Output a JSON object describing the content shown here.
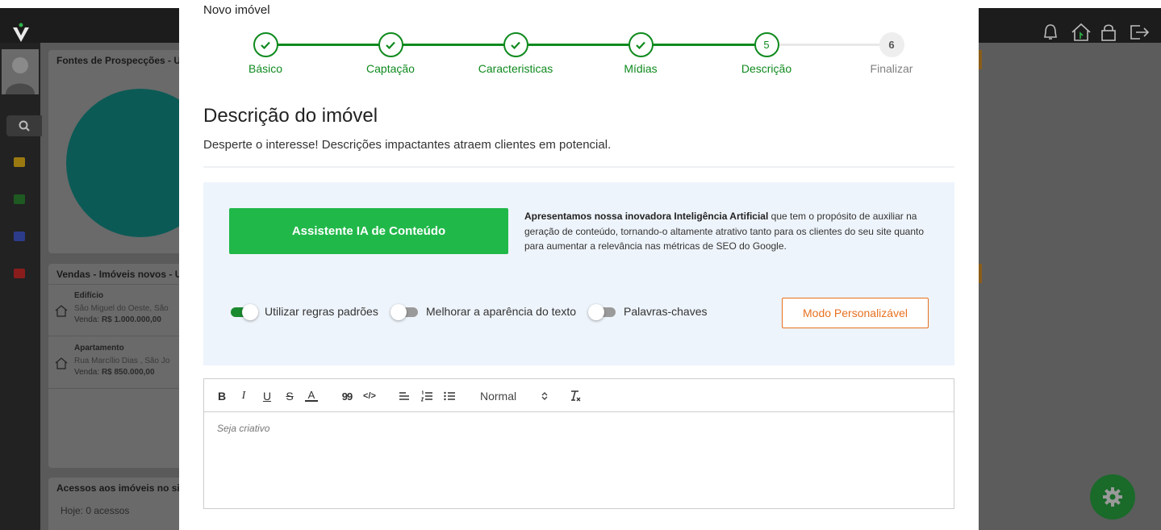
{
  "background": {
    "panels": {
      "sources_title": "Fontes de Prospecções - U",
      "sales_title": "Vendas - Imóveis novos - U",
      "access_title": "Acessos aos imóveis no si",
      "access_today_label": "Hoje:",
      "access_today_value": "0 acessos"
    },
    "sales_items": [
      {
        "type": "Edifício",
        "address": "São Miguel do Oeste, São",
        "price_label": "Venda:",
        "price": "R$ 1.000.000,00"
      },
      {
        "type": "Apartamento",
        "address": "Rua Marcílio Dias , São Jo",
        "price_label": "Venda:",
        "price": "R$ 850.000,00"
      }
    ],
    "icons": [
      "bell-icon",
      "home-icon",
      "lock-icon",
      "logout-icon",
      "gear-icon"
    ]
  },
  "modal": {
    "title": "Novo imóvel",
    "steps": [
      {
        "label": "Básico",
        "state": "done"
      },
      {
        "label": "Captação",
        "state": "done"
      },
      {
        "label": "Caracteristicas",
        "state": "done"
      },
      {
        "label": "Mídias",
        "state": "done"
      },
      {
        "label": "Descrição",
        "state": "current",
        "number": "5"
      },
      {
        "label": "Finalizar",
        "state": "todo",
        "number": "6"
      }
    ],
    "heading": "Descrição do imóvel",
    "subheading": "Desperte o interesse! Descrições impactantes atraem clientes em potencial.",
    "ai": {
      "button": "Assistente IA de Conteúdo",
      "desc_bold": "Apresentamos nossa inovadora Inteligência Artificial",
      "desc_rest": " que tem o propósito de auxiliar na geração de conteúdo, tornando-o altamente atrativo tanto para os clientes do seu site quanto para aumentar a relevância nas métricas de SEO do Google."
    },
    "toggles": [
      {
        "label": "Utilizar regras padrões",
        "on": true
      },
      {
        "label": "Melhorar a aparência do texto",
        "on": false
      },
      {
        "label": "Palavras-chaves",
        "on": false
      }
    ],
    "custom_mode_button": "Modo Personalizável",
    "editor": {
      "bold": "B",
      "italic": "I",
      "underline": "U",
      "strike": "S",
      "color": "A",
      "quote": "99",
      "code": "</>",
      "format": "Normal",
      "placeholder": "Seja criativo"
    }
  },
  "colors": {
    "accent_green": "#0f8a1e",
    "button_green": "#21b84a",
    "orange": "#e8711f"
  }
}
